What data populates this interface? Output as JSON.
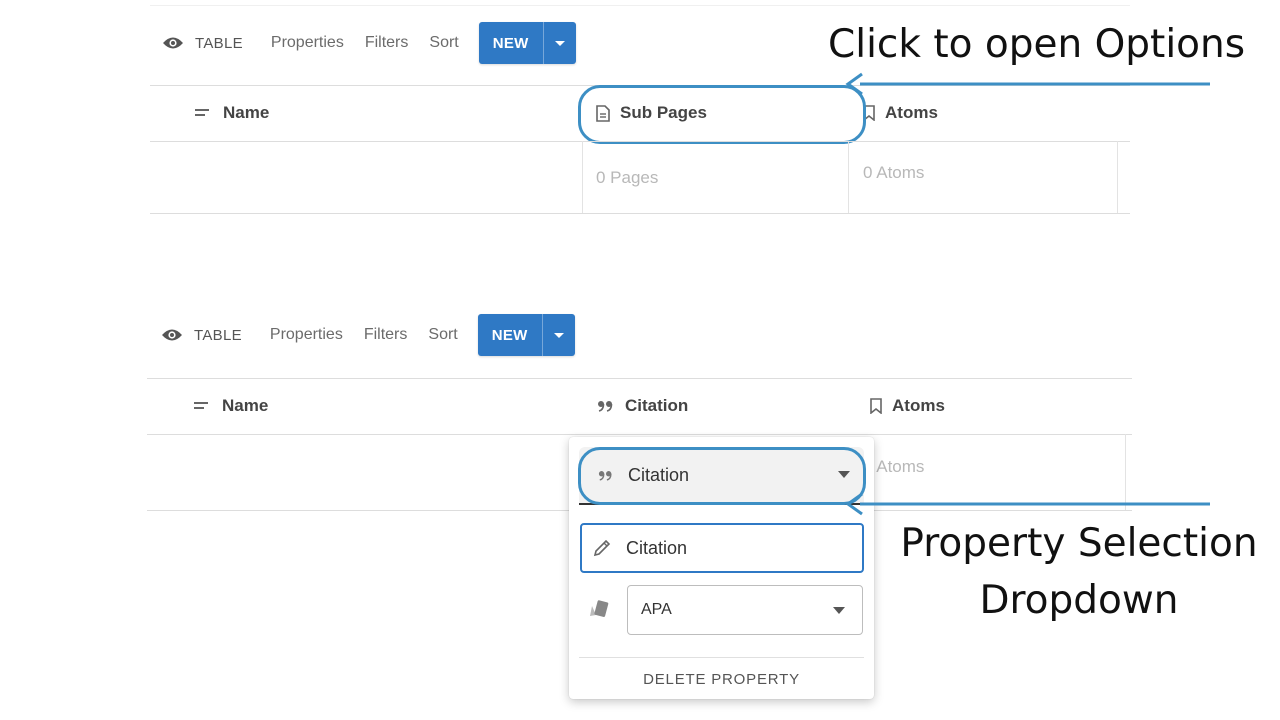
{
  "top": {
    "view_label": "TABLE",
    "properties": "Properties",
    "filters": "Filters",
    "sort": "Sort",
    "new_label": "NEW",
    "columns": {
      "name": "Name",
      "col2": "Sub Pages",
      "col3": "Atoms"
    },
    "row": {
      "col2": "0 Pages",
      "col3": "0 Atoms"
    }
  },
  "bottom": {
    "view_label": "TABLE",
    "properties": "Properties",
    "filters": "Filters",
    "sort": "Sort",
    "new_label": "NEW",
    "columns": {
      "name": "Name",
      "col2": "Citation",
      "col3": "Atoms"
    },
    "row": {
      "col3": "0 Atoms"
    }
  },
  "popup": {
    "property_type": "Citation",
    "property_name": "Citation",
    "citation_style": "APA",
    "delete_label": "DELETE PROPERTY"
  },
  "annotations": {
    "options": "Click to open Options",
    "dropdown_line1": "Property Selection",
    "dropdown_line2": "Dropdown"
  },
  "colors": {
    "accent": "#2f79c5",
    "highlight": "#3d8fc4"
  }
}
